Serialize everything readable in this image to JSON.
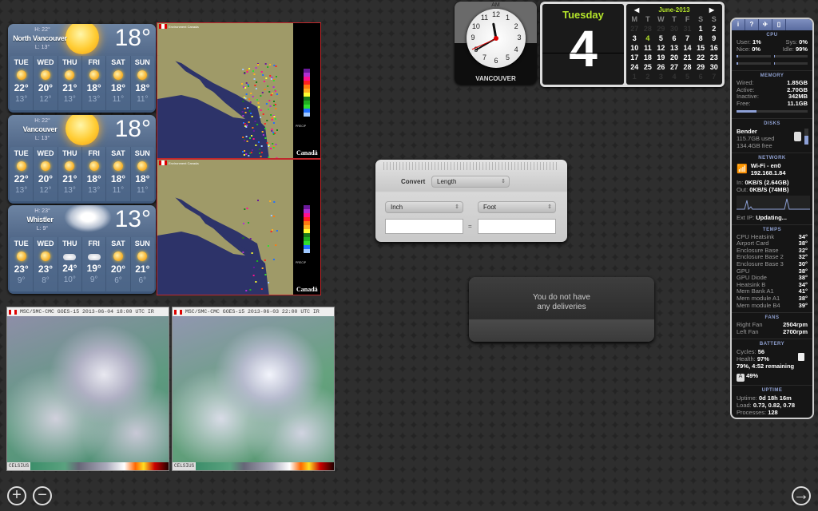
{
  "weather": [
    {
      "city": "North Vancouver",
      "high": "H: 22°",
      "low": "L: 13°",
      "current": "18°",
      "condition": "sunny-partly-cloudy",
      "days": [
        {
          "d": "TUE",
          "h": "22°",
          "l": "13°",
          "icon": "partly-sunny"
        },
        {
          "d": "WED",
          "h": "20°",
          "l": "12°",
          "icon": "partly-sunny"
        },
        {
          "d": "THU",
          "h": "21°",
          "l": "13°",
          "icon": "partly-sunny"
        },
        {
          "d": "FRI",
          "h": "18°",
          "l": "13°",
          "icon": "partly-sunny"
        },
        {
          "d": "SAT",
          "h": "18°",
          "l": "11°",
          "icon": "partly-sunny"
        },
        {
          "d": "SUN",
          "h": "18°",
          "l": "11°",
          "icon": "sunny"
        }
      ]
    },
    {
      "city": "Vancouver",
      "high": "H: 22°",
      "low": "L: 13°",
      "current": "18°",
      "condition": "sunny-partly-cloudy",
      "days": [
        {
          "d": "TUE",
          "h": "22°",
          "l": "13°",
          "icon": "partly-sunny"
        },
        {
          "d": "WED",
          "h": "20°",
          "l": "12°",
          "icon": "partly-sunny"
        },
        {
          "d": "THU",
          "h": "21°",
          "l": "13°",
          "icon": "partly-sunny"
        },
        {
          "d": "FRI",
          "h": "18°",
          "l": "13°",
          "icon": "partly-sunny"
        },
        {
          "d": "SAT",
          "h": "18°",
          "l": "11°",
          "icon": "partly-sunny"
        },
        {
          "d": "SUN",
          "h": "18°",
          "l": "11°",
          "icon": "sunny"
        }
      ]
    },
    {
      "city": "Whistler",
      "high": "H: 23°",
      "low": "L: 9°",
      "current": "13°",
      "condition": "cloudy",
      "days": [
        {
          "d": "TUE",
          "h": "23°",
          "l": "9°",
          "icon": "partly-sunny"
        },
        {
          "d": "WED",
          "h": "23°",
          "l": "8°",
          "icon": "partly-sunny"
        },
        {
          "d": "THU",
          "h": "24°",
          "l": "10°",
          "icon": "cloudy"
        },
        {
          "d": "FRI",
          "h": "19°",
          "l": "9°",
          "icon": "cloudy"
        },
        {
          "d": "SAT",
          "h": "20°",
          "l": "6°",
          "icon": "partly-sunny"
        },
        {
          "d": "SUN",
          "h": "21°",
          "l": "6°",
          "icon": "sunny"
        }
      ]
    }
  ],
  "radar": {
    "agency": "Environment Canada",
    "precip": "PRECIP",
    "wordmark": "Canadä",
    "scale": [
      "200",
      "100",
      "50",
      "24",
      "12",
      "4",
      "1",
      "0.1"
    ],
    "colors": [
      "#6a1a9a",
      "#b030d0",
      "#ff1090",
      "#ff2020",
      "#ff7a10",
      "#ffb020",
      "#ffff30",
      "#1a7a1a",
      "#20b020",
      "#30e030",
      "#2070ff",
      "#a0c8ff"
    ]
  },
  "satellite": [
    {
      "title": "MSC/SMC-CMC  GOES-15 2013-06-04 18:00 UTC  IR",
      "scale_label": "CELSIUS"
    },
    {
      "title": "MSC/SMC-CMC  GOES-15 2013-06-03 22:00 UTC  IR",
      "scale_label": "CELSIUS"
    }
  ],
  "clock": {
    "period": "AM",
    "city": "VANCOUVER",
    "hands": {
      "hour": 11,
      "minute": 40,
      "second": 41
    }
  },
  "date": {
    "weekday": "Tuesday",
    "day": "4"
  },
  "calendar": {
    "month": "June-2013",
    "prev": "◀",
    "next": "▶",
    "headers": [
      "M",
      "T",
      "W",
      "T",
      "F",
      "S",
      "S"
    ],
    "weeks": [
      [
        "27",
        "28",
        "29",
        "30",
        "31",
        "1",
        "2"
      ],
      [
        "3",
        "4",
        "5",
        "6",
        "7",
        "8",
        "9"
      ],
      [
        "10",
        "11",
        "12",
        "13",
        "14",
        "15",
        "16"
      ],
      [
        "17",
        "18",
        "19",
        "20",
        "21",
        "22",
        "23"
      ],
      [
        "24",
        "25",
        "26",
        "27",
        "28",
        "29",
        "30"
      ],
      [
        "1",
        "2",
        "3",
        "4",
        "5",
        "6",
        "7"
      ]
    ],
    "today": "4"
  },
  "converter": {
    "label": "Convert",
    "category": "Length",
    "from_unit": "Inch",
    "to_unit": "Foot",
    "from_value": "",
    "to_value": "",
    "equals": "="
  },
  "deliveries": {
    "message_line1": "You do not have",
    "message_line2": "any deliveries"
  },
  "istat": {
    "tabs": [
      "i",
      "?",
      "✈",
      "▯"
    ],
    "cpu": {
      "title": "CPU",
      "user_label": "User:",
      "user": "1%",
      "sys_label": "Sys:",
      "sys": "0%",
      "nice_label": "Nice:",
      "nice": "0%",
      "idle_label": "Idle:",
      "idle": "99%"
    },
    "memory": {
      "title": "MEMORY",
      "rows": [
        [
          "Wired:",
          "1.85GB"
        ],
        [
          "Active:",
          "2.70GB"
        ],
        [
          "Inactive:",
          "342MB"
        ],
        [
          "Free:",
          "11.1GB"
        ]
      ],
      "used_fraction": 0.28
    },
    "disks": {
      "title": "DISKS",
      "name": "Bender",
      "used": "115.7GB used",
      "free": "134.4GB free"
    },
    "network": {
      "title": "NETWORK",
      "interface": "Wi-Fi - en0",
      "ip": "192.168.1.84",
      "in_label": "In:",
      "in": "0KB/S (2.64GB)",
      "out_label": "Out:",
      "out": "0KB/S (74MB)",
      "ext_label": "Ext IP:",
      "ext": "Updating..."
    },
    "temps": {
      "title": "TEMPS",
      "rows": [
        [
          "CPU Heatsink",
          "34°"
        ],
        [
          "Airport Card",
          "38°"
        ],
        [
          "Enclosure Base",
          "32°"
        ],
        [
          "Enclosure Base 2",
          "32°"
        ],
        [
          "Enclosure Base 3",
          "30°"
        ],
        [
          "GPU",
          "38°"
        ],
        [
          "GPU Diode",
          "38°"
        ],
        [
          "Heatsink B",
          "34°"
        ],
        [
          "Mem Bank A1",
          "41°"
        ],
        [
          "Mem module A1",
          "38°"
        ],
        [
          "Mem module B4",
          "39°"
        ]
      ]
    },
    "fans": {
      "title": "FANS",
      "rows": [
        [
          "Right Fan",
          "2504rpm"
        ],
        [
          "Left Fan",
          "2700rpm"
        ]
      ]
    },
    "battery": {
      "title": "BATTERY",
      "cycles_label": "Cycles:",
      "cycles": "56",
      "health_label": "Health:",
      "health": "97%",
      "status": "79%, 4:52 remaining",
      "kbd": "49%"
    },
    "uptime": {
      "title": "UPTIME",
      "uptime_label": "Uptime:",
      "uptime": "0d 18h 16m",
      "load_label": "Load:",
      "load": "0.73, 0.82, 0.78",
      "proc_label": "Processes:",
      "proc": "128"
    }
  },
  "controls": {
    "add": "+",
    "remove": "−",
    "next": "→"
  }
}
